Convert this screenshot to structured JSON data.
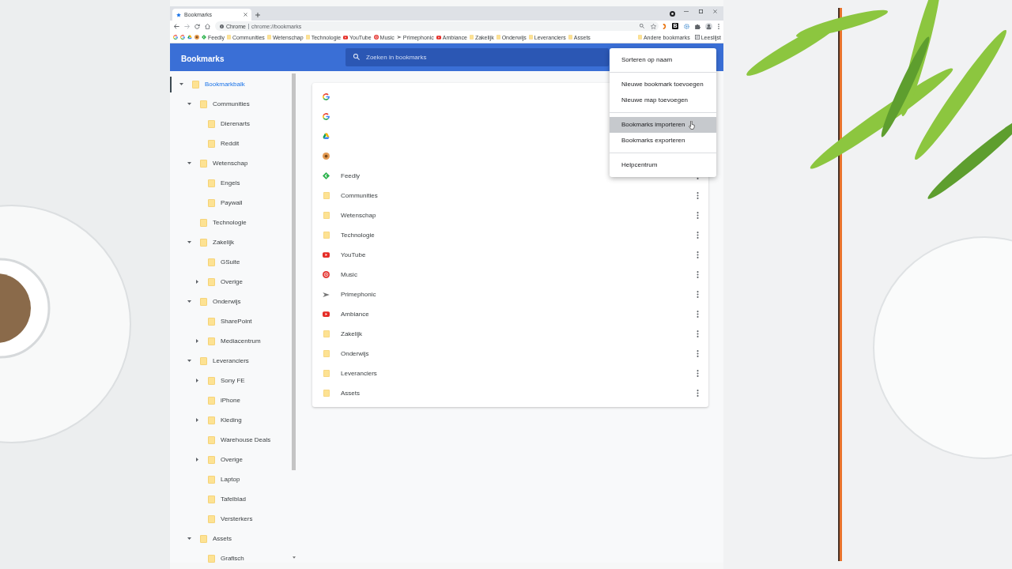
{
  "browser": {
    "tab": {
      "title": "Bookmarks"
    },
    "address": {
      "source": "Chrome",
      "url": "chrome://bookmarks"
    },
    "extension_badge": "B",
    "bookmarks_bar": [
      {
        "kind": "google"
      },
      {
        "kind": "google"
      },
      {
        "kind": "drive"
      },
      {
        "kind": "site"
      },
      {
        "kind": "feedly",
        "label": "Feedly"
      },
      {
        "kind": "folder",
        "label": "Communities"
      },
      {
        "kind": "folder",
        "label": "Wetenschap"
      },
      {
        "kind": "folder",
        "label": "Technologie"
      },
      {
        "kind": "youtube",
        "label": "YouTube"
      },
      {
        "kind": "music",
        "label": "Music"
      },
      {
        "kind": "primephonic",
        "label": "Primephonic"
      },
      {
        "kind": "youtube",
        "label": "Ambiance"
      },
      {
        "kind": "folder",
        "label": "Zakelijk"
      },
      {
        "kind": "folder",
        "label": "Onderwijs"
      },
      {
        "kind": "folder",
        "label": "Leveranciers"
      },
      {
        "kind": "folder",
        "label": "Assets"
      }
    ],
    "bookmarks_bar_end": [
      {
        "kind": "folder",
        "label": "Andere bookmarks"
      },
      {
        "kind": "reading_list",
        "label": "Leeslijst"
      }
    ]
  },
  "header": {
    "title": "Bookmarks",
    "search": {
      "placeholder": "Zoeken in bookmarks"
    }
  },
  "sidebar": {
    "tree": [
      {
        "label": "Bookmarkbalk",
        "selected": true,
        "expanded": true,
        "children": [
          {
            "label": "Communities",
            "selected": false,
            "expanded": true,
            "children": [
              {
                "label": "Dierenarts",
                "selected": false
              },
              {
                "label": "Reddit",
                "selected": false
              }
            ]
          },
          {
            "label": "Wetenschap",
            "selected": false,
            "expanded": true,
            "children": [
              {
                "label": "Engels",
                "selected": false
              },
              {
                "label": "Paywall",
                "selected": false
              }
            ]
          },
          {
            "label": "Technologie",
            "selected": false
          },
          {
            "label": "Zakelijk",
            "selected": false,
            "expanded": true,
            "children": [
              {
                "label": "GSuite",
                "selected": false
              },
              {
                "label": "Overige",
                "selected": false,
                "expanded": false
              }
            ]
          },
          {
            "label": "Onderwijs",
            "selected": false,
            "expanded": true,
            "children": [
              {
                "label": "SharePoint",
                "selected": false
              },
              {
                "label": "Mediacentrum",
                "selected": false,
                "expanded": false
              }
            ]
          },
          {
            "label": "Leveranciers",
            "selected": false,
            "expanded": true,
            "children": [
              {
                "label": "Sony FE",
                "selected": false,
                "expanded": false
              },
              {
                "label": "iPhone",
                "selected": false
              },
              {
                "label": "Kleding",
                "selected": false,
                "expanded": false
              },
              {
                "label": "Warehouse Deals",
                "selected": false
              },
              {
                "label": "Overige",
                "selected": false,
                "expanded": false
              },
              {
                "label": "Laptop",
                "selected": false
              },
              {
                "label": "Tafelblad",
                "selected": false
              },
              {
                "label": "Versterkers",
                "selected": false
              }
            ]
          },
          {
            "label": "Assets",
            "selected": false,
            "expanded": true,
            "children": [
              {
                "label": "Grafisch",
                "selected": false
              }
            ]
          }
        ]
      }
    ]
  },
  "list": {
    "rows": [
      {
        "kind": "google"
      },
      {
        "kind": "google"
      },
      {
        "kind": "drive"
      },
      {
        "kind": "site"
      },
      {
        "kind": "feedly",
        "label": "Feedly"
      },
      {
        "kind": "folder",
        "label": "Communities"
      },
      {
        "kind": "folder",
        "label": "Wetenschap"
      },
      {
        "kind": "folder",
        "label": "Technologie"
      },
      {
        "kind": "youtube",
        "label": "YouTube"
      },
      {
        "kind": "music",
        "label": "Music"
      },
      {
        "kind": "primephonic",
        "label": "Primephonic"
      },
      {
        "kind": "youtube",
        "label": "Ambiance"
      },
      {
        "kind": "folder",
        "label": "Zakelijk"
      },
      {
        "kind": "folder",
        "label": "Onderwijs"
      },
      {
        "kind": "folder",
        "label": "Leveranciers"
      },
      {
        "kind": "folder",
        "label": "Assets"
      }
    ]
  },
  "menu": {
    "sections": [
      {
        "items": [
          {
            "label": "Sorteren op naam",
            "highlighted": false
          }
        ]
      },
      {
        "items": [
          {
            "label": "Nieuwe bookmark toevoegen",
            "highlighted": false
          },
          {
            "label": "Nieuwe map toevoegen",
            "highlighted": false
          }
        ]
      },
      {
        "items": [
          {
            "label": "Bookmarks importeren",
            "highlighted": true
          },
          {
            "label": "Bookmarks exporteren",
            "highlighted": false
          }
        ]
      },
      {
        "items": [
          {
            "label": "Helpcentrum",
            "highlighted": false
          }
        ]
      }
    ]
  }
}
